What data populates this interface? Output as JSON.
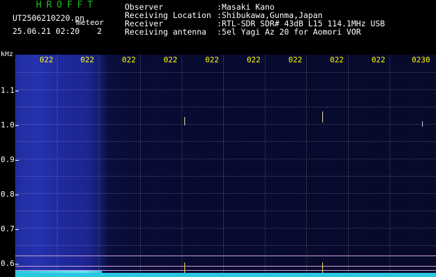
{
  "header": {
    "brand": "HROFFT",
    "filename": "UT2506210220.pn",
    "meteor_label": "meteor",
    "datetime": "25.06.21 02:20",
    "sequence": "2",
    "fields": [
      {
        "label": "Observer",
        "value": ":Masaki Kano"
      },
      {
        "label": "Receiving Location",
        "value": ":Shibukawa,Gunma,Japan"
      },
      {
        "label": "Receiver",
        "value": ":RTL-SDR SDR# 43dB L15 114.1MHz USB"
      },
      {
        "label": "Receiving antenna",
        "value": ":5el Yagi Az 20 for Aomori VOR"
      }
    ]
  },
  "axis": {
    "y_unit": "kHz",
    "y_ticks": [
      "1.1",
      "1.0",
      "0.9",
      "0.8",
      "0.7",
      "0.6"
    ],
    "x_ticks": [
      "022",
      "022",
      "022",
      "022",
      "022",
      "022",
      "022",
      "022",
      "022",
      "0230"
    ]
  },
  "colors": {
    "brand": "#1ec21e",
    "time_labels": "#ffff00",
    "meteor_echo": "#ffd860",
    "noise_floor": "#29c7e0"
  }
}
